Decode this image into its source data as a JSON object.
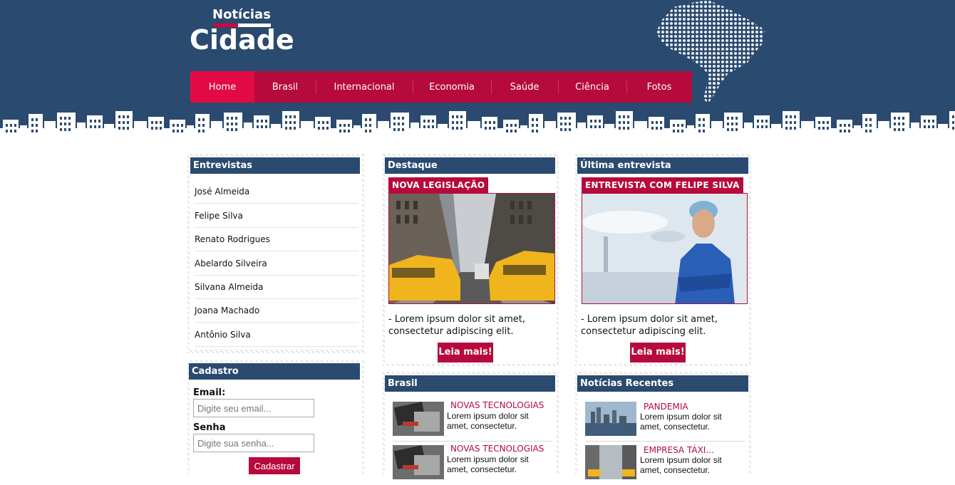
{
  "logo": {
    "top": "Notícias",
    "main": "Cidade"
  },
  "nav": {
    "items": [
      {
        "label": "Home"
      },
      {
        "label": "Brasil"
      },
      {
        "label": "Internacional"
      },
      {
        "label": "Economia"
      },
      {
        "label": "Saúde"
      },
      {
        "label": "Ciência"
      },
      {
        "label": "Fotos"
      }
    ]
  },
  "entrevistas": {
    "title": "Entrevistas",
    "items": [
      "José Almeida",
      "Felipe Silva",
      "Renato Rodrigues",
      "Abelardo Silveira",
      "Silvana Almeida",
      "Joana Machado",
      "Antônio Silva"
    ]
  },
  "cadastro": {
    "title": "Cadastro",
    "email_label": "Email:",
    "email_placeholder": "Digite seu email...",
    "senha_label": "Senha",
    "senha_placeholder": "Digite sua senha...",
    "button": "Cadastrar"
  },
  "destaque": {
    "title": "Destaque",
    "tag": "NOVA LEGISLAÇÃO",
    "desc": "- Lorem ipsum dolor sit amet, consectetur adipiscing elit.",
    "button": "Leia mais!"
  },
  "ultima": {
    "title": "Última entrevista",
    "tag": "ENTREVISTA COM FELIPE SILVA",
    "desc": "- Lorem ipsum dolor sit amet, consectetur adipiscing elit.",
    "button": "Leia mais!"
  },
  "brasil": {
    "title": "Brasil",
    "items": [
      {
        "title": "NOVAS TECNOLOGIAS",
        "text": "Lorem ipsum dolor sit amet, consectetur."
      },
      {
        "title": "NOVAS TECNOLOGIAS",
        "text": "Lorem ipsum dolor sit amet, consectetur."
      }
    ]
  },
  "recentes": {
    "title": "Notícias Recentes",
    "items": [
      {
        "title": "PANDEMIA",
        "text": "Lorem ipsum dolor sit amet, consectetur."
      },
      {
        "title": "EMPRESA TÁXI...",
        "text": "Lorem ipsum dolor sit amet, consectetur."
      }
    ]
  },
  "colors": {
    "header_blue": "#2a4a6f",
    "nav_red": "#b70a3c",
    "nav_active": "#e20a45",
    "accent_red": "#d8003f"
  }
}
